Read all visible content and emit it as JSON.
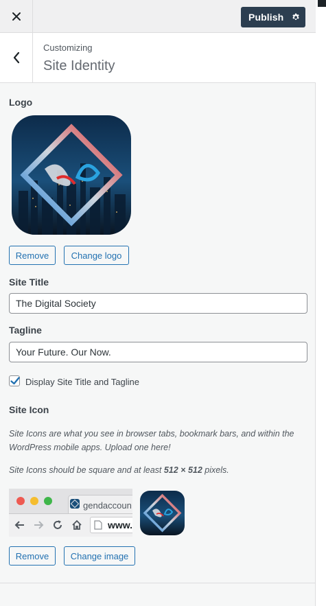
{
  "topbar": {
    "publish_label": "Publish"
  },
  "header": {
    "breadcrumb": "Customizing",
    "title": "Site Identity"
  },
  "logo_section": {
    "label": "Logo",
    "remove_label": "Remove",
    "change_label": "Change logo"
  },
  "site_title": {
    "label": "Site Title",
    "value": "The Digital Society"
  },
  "tagline": {
    "label": "Tagline",
    "value": "Your Future. Our Now."
  },
  "display_checkbox": {
    "label": "Display Site Title and Tagline",
    "checked": true
  },
  "site_icon": {
    "label": "Site Icon",
    "description_1": "Site Icons are what you see in browser tabs, bookmark bars, and within the WordPress mobile apps. Upload one here!",
    "description_2_prefix": "Site Icons should be square and at least ",
    "description_2_size": "512 × 512",
    "description_2_suffix": " pixels.",
    "browser_tab_text": "gendaccoun",
    "browser_url_text": "www.",
    "remove_label": "Remove",
    "change_label": "Change image"
  },
  "colors": {
    "publish_bg": "#2c3e50",
    "accent": "#2271b1",
    "panel_bg": "#f6f7f7"
  },
  "icons": [
    "close-icon",
    "gear-icon",
    "chevron-left-icon",
    "checkmark-icon",
    "back-arrow-icon",
    "forward-arrow-icon",
    "reload-icon",
    "home-icon",
    "page-icon"
  ]
}
